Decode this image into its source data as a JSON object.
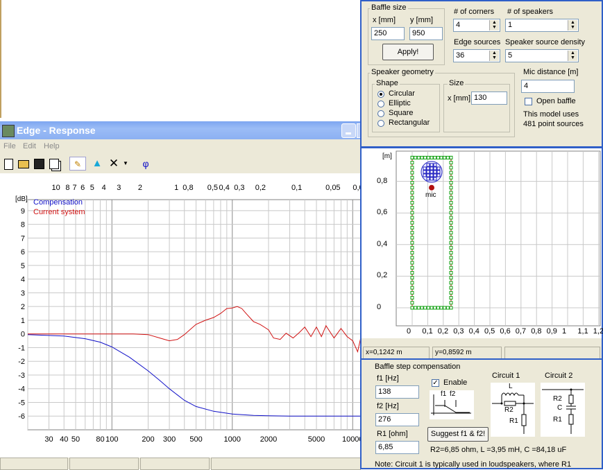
{
  "response_window": {
    "title": "Edge - Response",
    "menu": [
      "File",
      "Edit",
      "Help"
    ],
    "toolbar_phi": "φ",
    "legend": {
      "compensation": "Compensation",
      "current_system": "Current system"
    },
    "y_unit": "[dB]",
    "y_ticks": [
      "9",
      "8",
      "7",
      "6",
      "5",
      "4",
      "3",
      "2",
      "1",
      "0",
      "-1",
      "-2",
      "-3",
      "-4",
      "-5",
      "-6"
    ],
    "x_ticks_bottom": [
      "30",
      "40",
      "50",
      "80",
      "100",
      "200",
      "300",
      "500",
      "1000",
      "2000",
      "5000",
      "10000"
    ],
    "x_ticks_top": [
      "10",
      "8",
      "7",
      "6",
      "5",
      "4",
      "3",
      "2",
      "1",
      "0,8",
      "0,5",
      "0,4",
      "0,3",
      "0,2",
      "0,1",
      "0,05",
      "0,0"
    ]
  },
  "chart_data": {
    "type": "line",
    "x_scale": "log",
    "xlim": [
      20,
      12000
    ],
    "ylim": [
      -7,
      9.5
    ],
    "ylabel": "[dB]",
    "series": [
      {
        "name": "Compensation",
        "color": "#1010c8",
        "x": [
          20,
          40,
          60,
          80,
          100,
          140,
          200,
          250,
          300,
          400,
          500,
          700,
          1000,
          1500,
          2000,
          3000,
          5000,
          10000,
          12000
        ],
        "y": [
          -0.05,
          -0.15,
          -0.35,
          -0.6,
          -0.95,
          -1.7,
          -2.7,
          -3.4,
          -4.0,
          -4.85,
          -5.3,
          -5.65,
          -5.85,
          -5.95,
          -5.98,
          -6.0,
          -6.0,
          -6.0,
          -6.0
        ]
      },
      {
        "name": "Current system",
        "color": "#d01010",
        "x": [
          20,
          100,
          150,
          200,
          250,
          300,
          350,
          400,
          500,
          600,
          700,
          800,
          900,
          1000,
          1100,
          1200,
          1300,
          1500,
          1700,
          2000,
          2200,
          2500,
          2800,
          3200,
          3600,
          4000,
          4500,
          5000,
          5500,
          6000,
          7000,
          8000,
          9000,
          10000,
          11000,
          12000
        ],
        "y": [
          0,
          0,
          0,
          -0.05,
          -0.3,
          -0.5,
          -0.4,
          -0.05,
          0.7,
          1.0,
          1.2,
          1.5,
          1.85,
          1.9,
          2.0,
          1.85,
          1.5,
          0.9,
          0.7,
          0.3,
          -0.3,
          -0.4,
          0.05,
          -0.3,
          0.1,
          0.5,
          -0.2,
          0.5,
          -0.2,
          0.6,
          -0.3,
          0.4,
          -0.2,
          -0.5,
          -1.3,
          0.2
        ]
      }
    ]
  },
  "settings": {
    "baffle_size_title": "Baffle size",
    "x_label": "x [mm]",
    "x_value": "250",
    "y_label": "y [mm]",
    "y_value": "950",
    "apply_label": "Apply!",
    "corners_label": "# of corners",
    "corners_value": "4",
    "speakers_label": "# of speakers",
    "speakers_value": "1",
    "edge_sources_label": "Edge sources",
    "edge_sources_value": "36",
    "density_label": "Speaker source density",
    "density_value": "5",
    "geometry_title": "Speaker geometry",
    "shape_title": "Shape",
    "shapes": [
      "Circular",
      "Elliptic",
      "Square",
      "Rectangular"
    ],
    "size_title": "Size",
    "size_label": "x [mm]",
    "size_value": "130",
    "mic_label": "Mic distance [m]",
    "mic_value": "4",
    "open_baffle_label": "Open baffle",
    "model_text_1": "This model uses",
    "model_text_2": "481 point sources"
  },
  "geometry_plot": {
    "y_unit": "[m]",
    "y_ticks": [
      "0,8",
      "0,6",
      "0,4",
      "0,2",
      "0"
    ],
    "x_ticks": [
      "0",
      "0,1",
      "0,2",
      "0,3",
      "0,4",
      "0,5",
      "0,6",
      "0,7",
      "0,8",
      "0,9",
      "1",
      "1,1",
      "1,2"
    ],
    "mic_label": "mic",
    "status_x": "x=0,1242 m",
    "status_y": "y=0,8592 m"
  },
  "compensation": {
    "title": "Baffle step compensation",
    "f1_label": "f1 [Hz]",
    "f1_value": "138",
    "f2_label": "f2 [Hz]",
    "f2_value": "276",
    "r1_label": "R1 [ohm]",
    "r1_value": "6,85",
    "enable_label": "Enable",
    "diagram_f1": "f1",
    "diagram_f2": "f2",
    "circuit1": "Circuit 1",
    "circuit2": "Circuit 2",
    "c1_L": "L",
    "c1_R2": "R2",
    "c1_R1": "R1",
    "c2_R2": "R2",
    "c2_C": "C",
    "c2_R1": "R1",
    "suggest_label": "Suggest f1 & f2!",
    "result_text": "R2=6,85 ohm, L =3,95 mH, C =84,18 uF",
    "note": "Note: Circuit 1 is typically used in loudspeakers, where R1"
  }
}
